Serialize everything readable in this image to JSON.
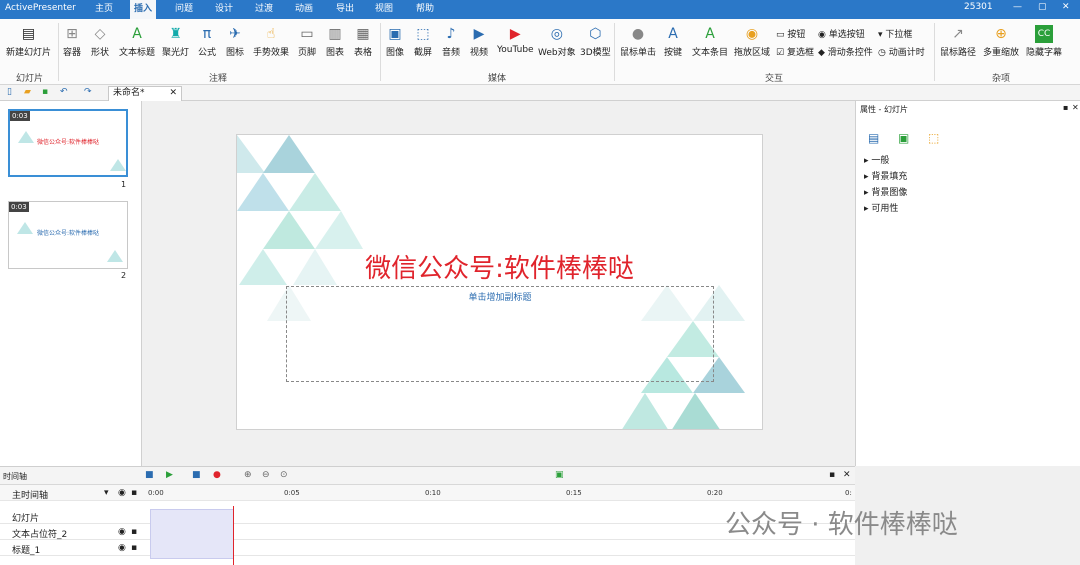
{
  "app": {
    "name": "ActivePresenter",
    "counter": "25301"
  },
  "menu": {
    "tabs": [
      "主页",
      "插入",
      "问题",
      "设计",
      "过渡",
      "动画",
      "导出",
      "视图",
      "帮助"
    ],
    "active": "插入"
  },
  "ribbon": {
    "slides_group": {
      "label": "幻灯片",
      "new_slide": "新建幻灯片"
    },
    "annot_group": {
      "label": "注释",
      "items": [
        "容器",
        "形状",
        "文本标题",
        "聚光灯",
        "公式",
        "图标",
        "手势效果",
        "页脚",
        "图表",
        "表格"
      ]
    },
    "media_group": {
      "label": "媒体",
      "items": [
        "图像",
        "截屏",
        "音频",
        "视频",
        "YouTube",
        "Web对象",
        "3D模型"
      ]
    },
    "interact_group": {
      "label": "交互",
      "items": [
        "鼠标单击",
        "按键",
        "文本条目",
        "拖放区域"
      ],
      "small": [
        "按钮",
        "单选按钮",
        "下拉框",
        "复选框",
        "滑动条控件",
        "动画计时"
      ]
    },
    "misc_group": {
      "label": "杂项",
      "items": [
        "鼠标路径",
        "多重缩放",
        "隐藏字幕"
      ]
    }
  },
  "doc": {
    "tab": "未命名*"
  },
  "slides": [
    {
      "num": "1",
      "time": "0:03",
      "title": "微信公众号:软件棒棒哒",
      "selected": true
    },
    {
      "num": "2",
      "time": "0:03",
      "title": "微信公众号:软件棒棒哒",
      "selected": false
    }
  ],
  "slide": {
    "title": "微信公众号:软件棒棒哒",
    "subtitle": "单击增加副标题"
  },
  "properties": {
    "title": "属性 - 幻灯片",
    "sections": [
      "一般",
      "背景填充",
      "背景图像",
      "可用性"
    ]
  },
  "timeline": {
    "title": "时间轴",
    "main": "主时间轴",
    "rows": [
      "幻灯片",
      "文本占位符_2",
      "标题_1"
    ],
    "ticks": [
      "0:00",
      "0:05",
      "0:10",
      "0:15",
      "0:20",
      "0:"
    ]
  },
  "watermark": "公众号 · 软件棒棒哒"
}
